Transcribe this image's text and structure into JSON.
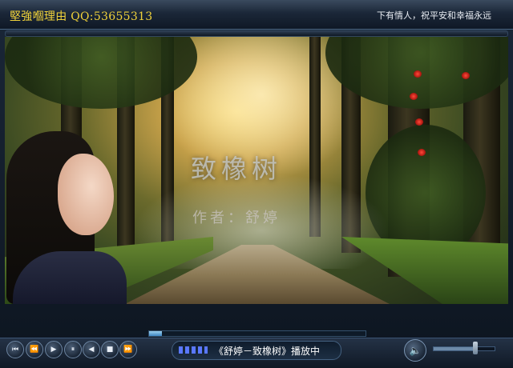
{
  "window": {
    "title": "堅強嗰理由 QQ:53655313",
    "marquee": "下有情人，祝平安和幸福永远"
  },
  "video": {
    "title_caption": "致橡树",
    "author_caption": "作者：舒婷"
  },
  "playback": {
    "progress": 0.06,
    "status_text": "《舒婷－致橡树》播放中",
    "volume": 0.7
  },
  "controls": {
    "buttons": [
      {
        "name": "first-track-button",
        "icon": "⏮"
      },
      {
        "name": "rewind-button",
        "icon": "⏪"
      },
      {
        "name": "play-button",
        "icon": "▶"
      },
      {
        "name": "pause-button",
        "icon": "⏸"
      },
      {
        "name": "step-back-button",
        "icon": "◀"
      },
      {
        "name": "stop-button",
        "icon": "■"
      },
      {
        "name": "fast-forward-button",
        "icon": "⏩"
      }
    ],
    "volume_icon": "🔈"
  },
  "colors": {
    "title_text": "#f0d23a",
    "accent": "#5a78ff"
  }
}
